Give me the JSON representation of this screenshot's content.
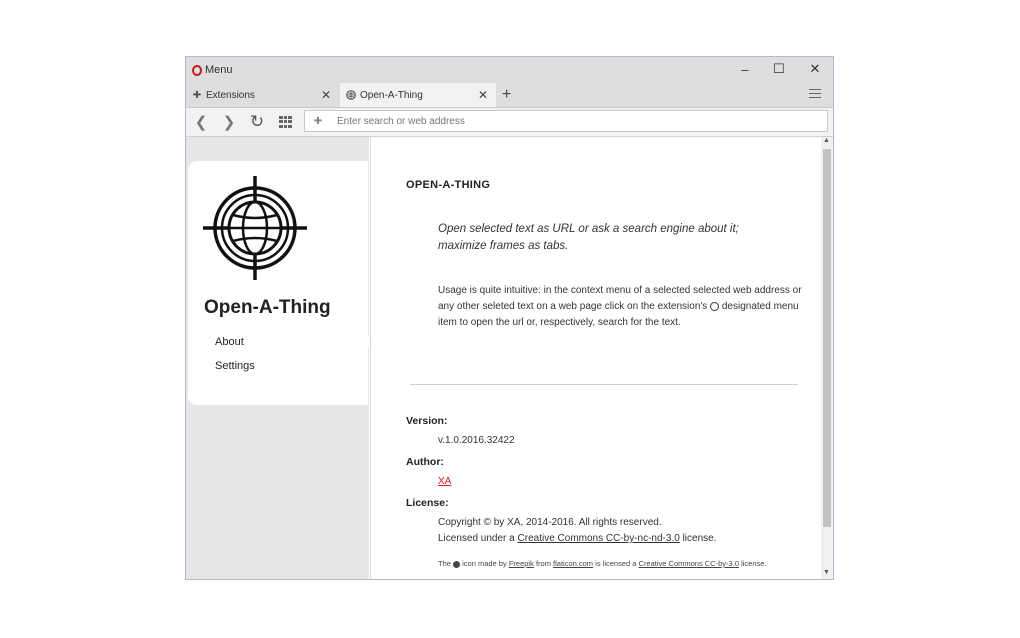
{
  "titlebar": {
    "menu_label": "Menu",
    "minimize": "–",
    "maximize": "☐",
    "close": "✕"
  },
  "tabs": [
    {
      "label": "Extensions",
      "icon": "puzzle-icon",
      "close": "✕"
    },
    {
      "label": "Open-A-Thing",
      "icon": "globe-icon",
      "close": "✕"
    }
  ],
  "new_tab": "+",
  "toolbar": {
    "back": "❮",
    "forward": "❯",
    "reload": "↻",
    "address_placeholder": "Enter search or web address"
  },
  "sidebar": {
    "extension_name": "Open-A-Thing",
    "nav": [
      {
        "label": "About"
      },
      {
        "label": "Settings"
      }
    ]
  },
  "about": {
    "title": "OPEN-A-THING",
    "tagline": "Open selected text as URL or ask a search engine about it; maximize frames as tabs.",
    "usage_part1": "Usage is quite intuitive: in the context menu of a selected selected web address or any other seleted text on a web page click on the extension's",
    "usage_part2": "designated menu item to open the url or, respectively, search for the text.",
    "version_label": "Version:",
    "version_value": "v.1.0.2016.32422",
    "author_label": "Author:",
    "author_value": "XA",
    "license_label": "License:",
    "copyright": "Copyright © by XA, 2014-2016. All rights reserved.",
    "licensed_prefix": "Licensed under a",
    "licensed_link": "Creative Commons CC-by-nc-nd-3.0",
    "licensed_suffix": "license.",
    "credit_the": "The",
    "credit_icon_made_by": "icon made by",
    "credit_author": "Freepik",
    "credit_from": "from",
    "credit_site": "flaticon.com",
    "credit_is_licensed": "is licensed a",
    "credit_license": "Creative Commons CC-by-3.0",
    "credit_end": "license."
  },
  "colors": {
    "opera_red": "#d0181f",
    "window_border": "#b8b4dc",
    "sidebar_bg": "#e6e6e6"
  }
}
